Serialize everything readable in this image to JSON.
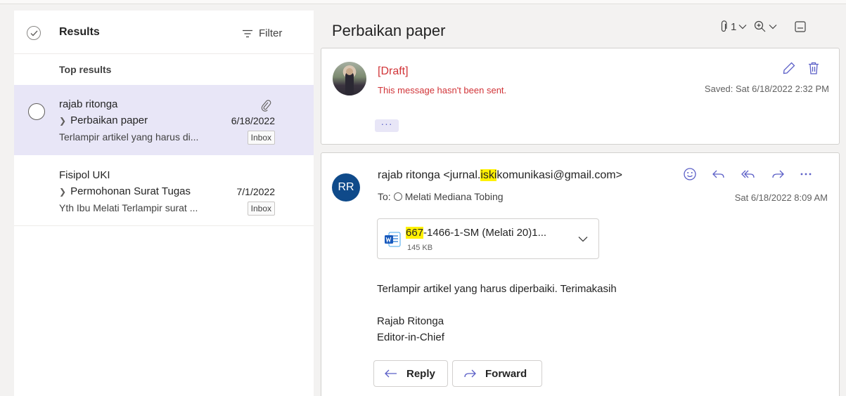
{
  "left_pane": {
    "header": {
      "title": "Results",
      "filter_label": "Filter"
    },
    "section_label": "Top results",
    "items": [
      {
        "sender": "rajab ritonga",
        "subject": "Perbaikan paper",
        "date": "6/18/2022",
        "preview": "Terlampir artikel yang harus di...",
        "folder": "Inbox",
        "has_attachment": true,
        "selected": true
      },
      {
        "sender": "Fisipol UKI",
        "subject": "Permohonan Surat Tugas",
        "date": "7/1/2022",
        "preview": "Yth Ibu Melati Terlampir surat ...",
        "folder": "Inbox",
        "has_attachment": false,
        "selected": false
      }
    ]
  },
  "reading_pane": {
    "subject": "Perbaikan paper",
    "toolbar": {
      "attachment_count": "1"
    },
    "draft": {
      "label": "[Draft]",
      "status": "This message hasn't been sent.",
      "saved": "Saved: Sat 6/18/2022 2:32 PM",
      "more": "···"
    },
    "message": {
      "avatar_initials": "RR",
      "from_name": "rajab ritonga <jurnal.",
      "from_highlight": "iski",
      "from_rest": "komunikasi@gmail.com>",
      "to_prefix": "To:",
      "to_name": "Melati Mediana Tobing",
      "date": "Sat 6/18/2022 8:09 AM",
      "attachment": {
        "name_highlight": "667",
        "name_rest": "-1466-1-SM (Melati 20)1...",
        "size": "145 KB"
      },
      "body": "Terlampir artikel yang harus diperbaiki. Terimakasih",
      "signature_name": "Rajab Ritonga",
      "signature_title": "Editor-in-Chief",
      "reply_label": "Reply",
      "forward_label": "Forward"
    }
  },
  "colors": {
    "accent": "#5b5fc7",
    "selected_bg": "#e8e6f7",
    "draft_red": "#d13438",
    "highlight": "#fff100",
    "avatar_blue": "#0f4a8a"
  }
}
